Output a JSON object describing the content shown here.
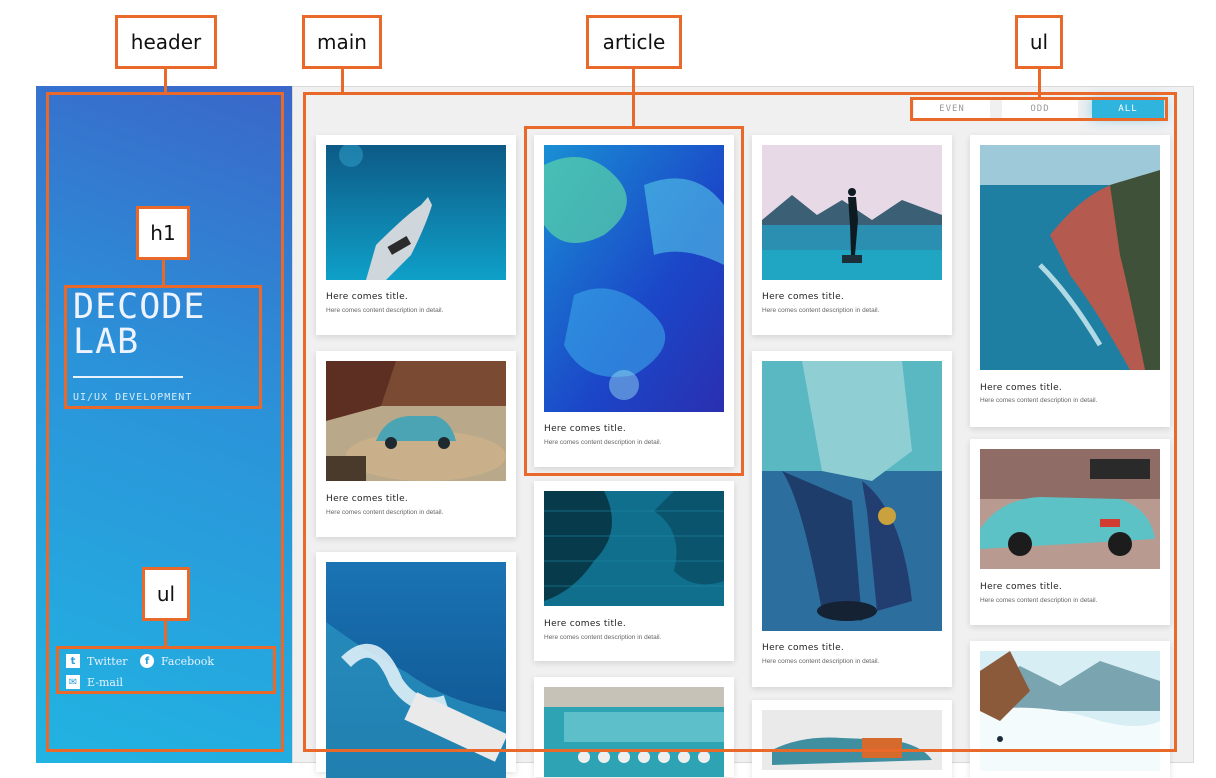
{
  "annotations": {
    "header": "header",
    "main": "main",
    "article": "article",
    "ul_filter": "ul",
    "h1": "h1",
    "ul_social": "ul"
  },
  "brand": {
    "line1": "DECODE",
    "line2": "LAB",
    "subtitle": "UI/UX DEVELOPMENT"
  },
  "social": {
    "twitter": "Twitter",
    "facebook": "Facebook",
    "email": "E-mail"
  },
  "filters": {
    "even": "EVEN",
    "odd": "ODD",
    "all": "ALL",
    "selected": "ALL"
  },
  "card_text": {
    "title": "Here comes title.",
    "description": "Here comes content description in detail."
  },
  "colors": {
    "annotation": "#e8692a",
    "header_gradient_top": "#3a66c9",
    "header_gradient_bottom": "#21b4e2",
    "accent": "#2fb4dd"
  }
}
